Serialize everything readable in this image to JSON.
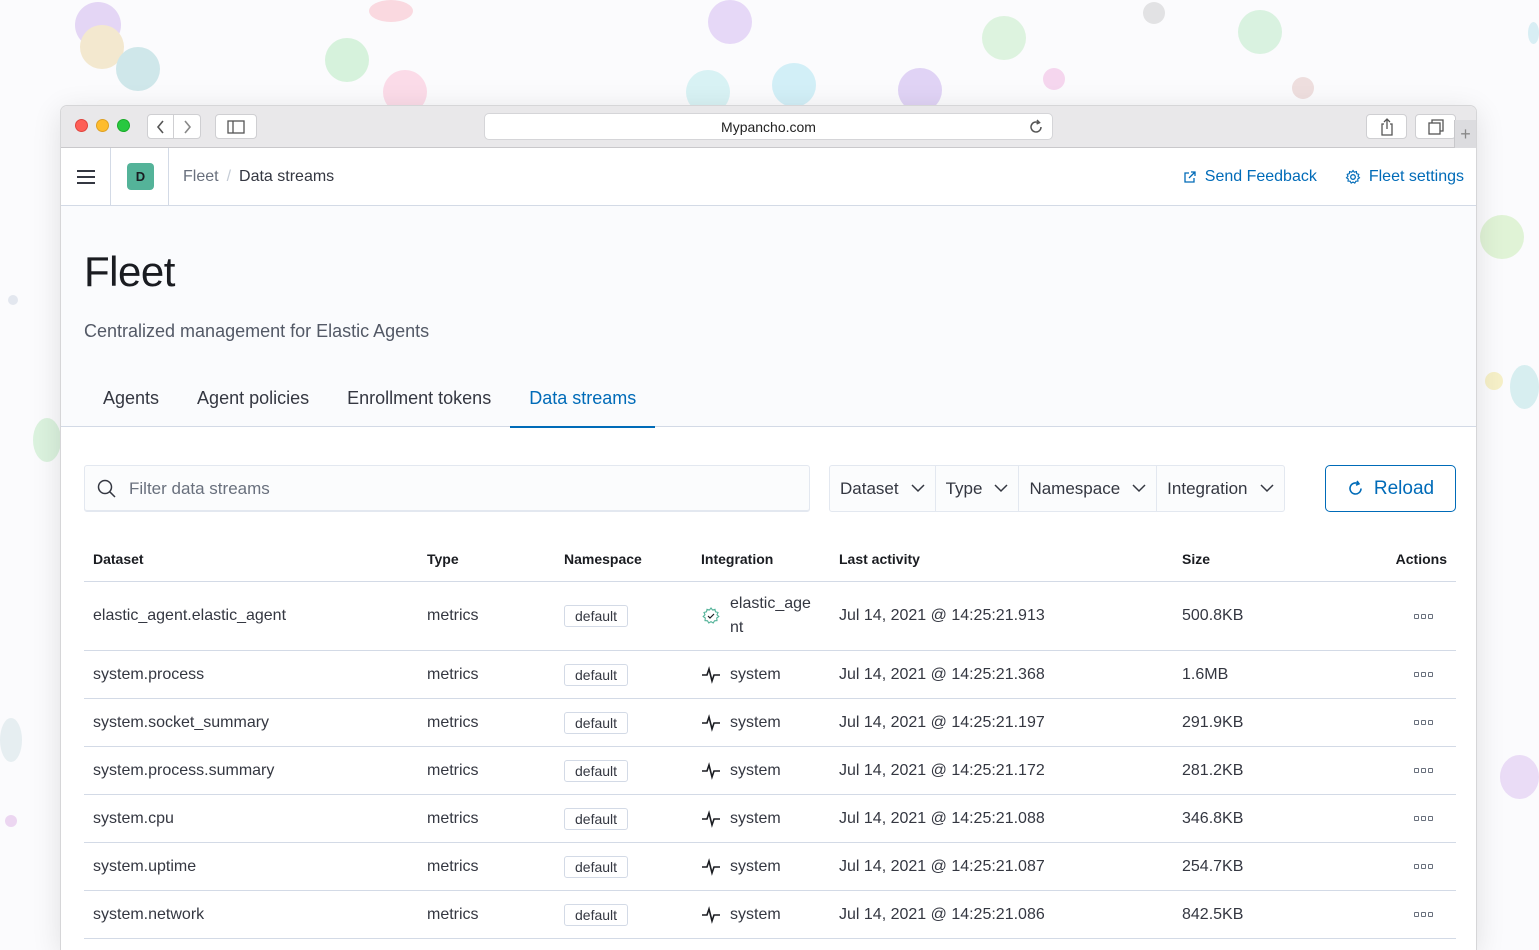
{
  "browser": {
    "url": "Mypancho.com"
  },
  "header": {
    "space_initial": "D",
    "breadcrumbs": [
      "Fleet",
      "Data streams"
    ],
    "send_feedback": "Send Feedback",
    "fleet_settings": "Fleet settings"
  },
  "page": {
    "title": "Fleet",
    "subtitle": "Centralized management for Elastic Agents",
    "tabs": [
      {
        "label": "Agents",
        "active": false
      },
      {
        "label": "Agent policies",
        "active": false
      },
      {
        "label": "Enrollment tokens",
        "active": false
      },
      {
        "label": "Data streams",
        "active": true
      }
    ]
  },
  "toolbar": {
    "search_placeholder": "Filter data streams",
    "filters": [
      "Dataset",
      "Type",
      "Namespace",
      "Integration"
    ],
    "reload_label": "Reload"
  },
  "table": {
    "columns": [
      "Dataset",
      "Type",
      "Namespace",
      "Integration",
      "Last activity",
      "Size",
      "Actions"
    ],
    "rows": [
      {
        "dataset": "elastic_agent.elastic_agent",
        "type": "metrics",
        "namespace": "default",
        "integration": "elastic_age nt",
        "integration_icon": "agent-gear-icon",
        "last_activity": "Jul 14, 2021 @ 14:25:21.913",
        "size": "500.8KB"
      },
      {
        "dataset": "system.process",
        "type": "metrics",
        "namespace": "default",
        "integration": "system",
        "integration_icon": "pulse-icon",
        "last_activity": "Jul 14, 2021 @ 14:25:21.368",
        "size": "1.6MB"
      },
      {
        "dataset": "system.socket_summary",
        "type": "metrics",
        "namespace": "default",
        "integration": "system",
        "integration_icon": "pulse-icon",
        "last_activity": "Jul 14, 2021 @ 14:25:21.197",
        "size": "291.9KB"
      },
      {
        "dataset": "system.process.summary",
        "type": "metrics",
        "namespace": "default",
        "integration": "system",
        "integration_icon": "pulse-icon",
        "last_activity": "Jul 14, 2021 @ 14:25:21.172",
        "size": "281.2KB"
      },
      {
        "dataset": "system.cpu",
        "type": "metrics",
        "namespace": "default",
        "integration": "system",
        "integration_icon": "pulse-icon",
        "last_activity": "Jul 14, 2021 @ 14:25:21.088",
        "size": "346.8KB"
      },
      {
        "dataset": "system.uptime",
        "type": "metrics",
        "namespace": "default",
        "integration": "system",
        "integration_icon": "pulse-icon",
        "last_activity": "Jul 14, 2021 @ 14:25:21.087",
        "size": "254.7KB"
      },
      {
        "dataset": "system.network",
        "type": "metrics",
        "namespace": "default",
        "integration": "system",
        "integration_icon": "pulse-icon",
        "last_activity": "Jul 14, 2021 @ 14:25:21.086",
        "size": "842.5KB"
      }
    ]
  },
  "colors": {
    "accent": "#006bb8",
    "space_avatar": "#54b399",
    "text": "#343741"
  }
}
